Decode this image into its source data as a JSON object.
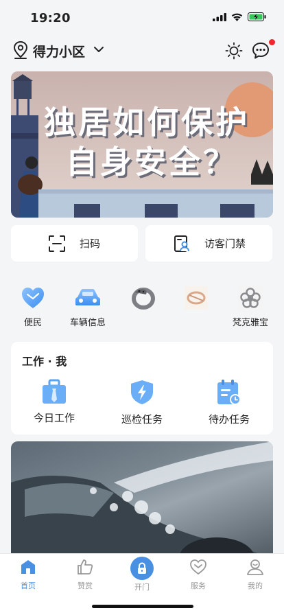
{
  "status": {
    "time": "19:20"
  },
  "header": {
    "community": "得力小区"
  },
  "banner": {
    "line1": "独居如何保护",
    "line2": "自身安全？"
  },
  "quick_actions": [
    {
      "label": "扫码",
      "icon": "scan-icon"
    },
    {
      "label": "访客门禁",
      "icon": "visitor-icon"
    }
  ],
  "services": [
    {
      "label": "便民",
      "icon": "heart-icon"
    },
    {
      "label": "车辆信息",
      "icon": "car-icon"
    },
    {
      "label": "",
      "icon": "ring-product-image"
    },
    {
      "label": "",
      "icon": "bracelet-product-image"
    },
    {
      "label": "梵克雅宝",
      "icon": "flower-jewelry-image"
    }
  ],
  "work": {
    "title": "工作 · 我",
    "items": [
      {
        "label": "今日工作",
        "icon": "briefcase-icon"
      },
      {
        "label": "巡检任务",
        "icon": "shield-bolt-icon"
      },
      {
        "label": "待办任务",
        "icon": "calendar-clock-icon"
      }
    ]
  },
  "tabs": [
    {
      "label": "首页",
      "icon": "home-icon",
      "active": true
    },
    {
      "label": "赞赏",
      "icon": "thumbs-up-icon",
      "active": false
    },
    {
      "label": "开门",
      "icon": "lock-icon",
      "active": false
    },
    {
      "label": "服务",
      "icon": "heart-outline-icon",
      "active": false
    },
    {
      "label": "我的",
      "icon": "user-icon",
      "active": false
    }
  ],
  "colors": {
    "accent": "#4a90e2",
    "notification": "#f0282d",
    "battery": "#34c759"
  }
}
